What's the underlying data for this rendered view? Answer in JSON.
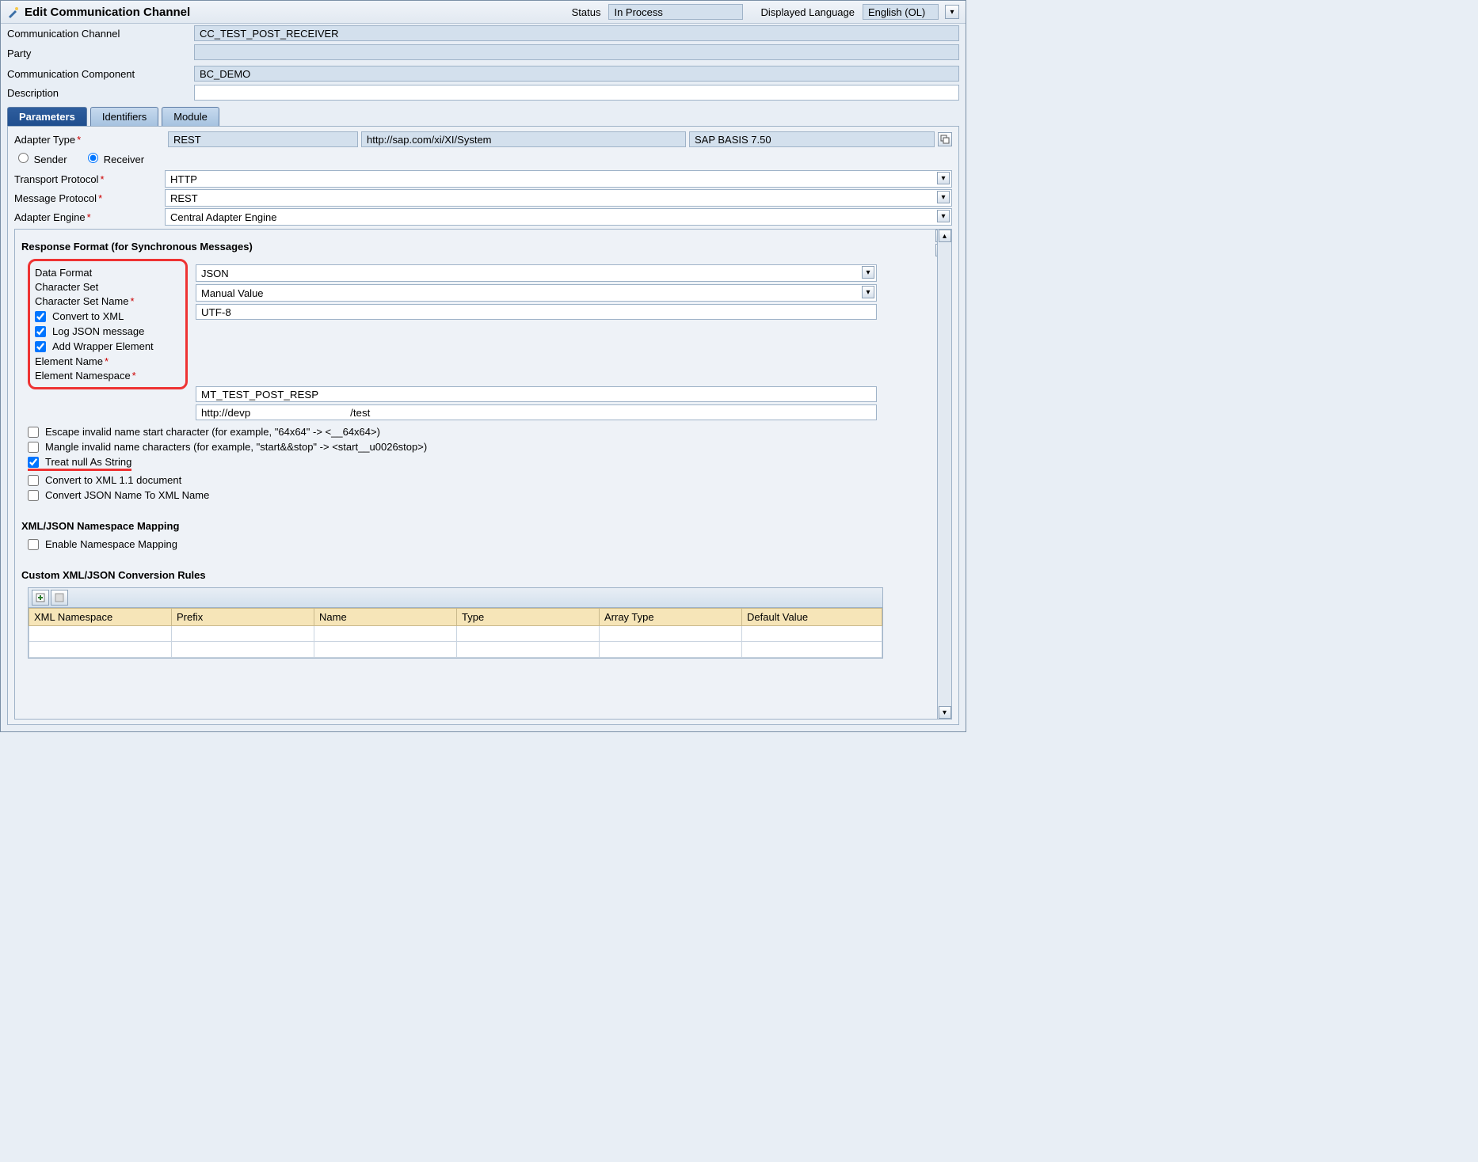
{
  "header": {
    "title": "Edit Communication Channel",
    "status_label": "Status",
    "status_value": "In Process",
    "lang_label": "Displayed Language",
    "lang_value": "English (OL)"
  },
  "fields": {
    "cc_label": "Communication Channel",
    "cc_value": "CC_TEST_POST_RECEIVER",
    "party_label": "Party",
    "party_value": "",
    "comp_label": "Communication Component",
    "comp_value": "BC_DEMO",
    "desc_label": "Description",
    "desc_value": ""
  },
  "tabs": {
    "t1": "Parameters",
    "t2": "Identifiers",
    "t3": "Module"
  },
  "adapter": {
    "type_label": "Adapter Type",
    "type_value": "REST",
    "ns": "http://sap.com/xi/XI/System",
    "ver": "SAP BASIS 7.50",
    "sender_label": "Sender",
    "receiver_label": "Receiver",
    "transport_label": "Transport Protocol",
    "transport_value": "HTTP",
    "message_label": "Message Protocol",
    "message_value": "REST",
    "engine_label": "Adapter Engine",
    "engine_value": "Central Adapter Engine"
  },
  "resp": {
    "section": "Response Format (for Synchronous Messages)",
    "data_format_label": "Data Format",
    "data_format_value": "JSON",
    "charset_label": "Character Set",
    "charset_value": "Manual Value",
    "charset_name_label": "Character Set Name",
    "charset_name_value": "UTF-8",
    "cb_convert_xml": "Convert to XML",
    "cb_log_json": "Log JSON message",
    "cb_wrapper": "Add Wrapper Element",
    "elem_name_label": "Element Name",
    "elem_name_value": "MT_TEST_POST_RESP",
    "elem_ns_label": "Element Namespace",
    "elem_ns_value": "http://devp                                  /test",
    "cb_escape": "Escape invalid name start character (for example, \"64x64\" -> <__64x64>)",
    "cb_mangle": "Mangle invalid name characters (for example, \"start&&stop\" -> <start__u0026stop>)",
    "cb_null": "Treat null As String",
    "cb_xml11": "Convert to XML 1.1 document",
    "cb_json2xml": "Convert JSON Name To XML Name"
  },
  "ns_map": {
    "section": "XML/JSON Namespace Mapping",
    "cb_enable": "Enable Namespace Mapping"
  },
  "rules": {
    "section": "Custom XML/JSON Conversion Rules",
    "cols": {
      "c1": "XML Namespace",
      "c2": "Prefix",
      "c3": "Name",
      "c4": "Type",
      "c5": "Array Type",
      "c6": "Default Value"
    }
  }
}
